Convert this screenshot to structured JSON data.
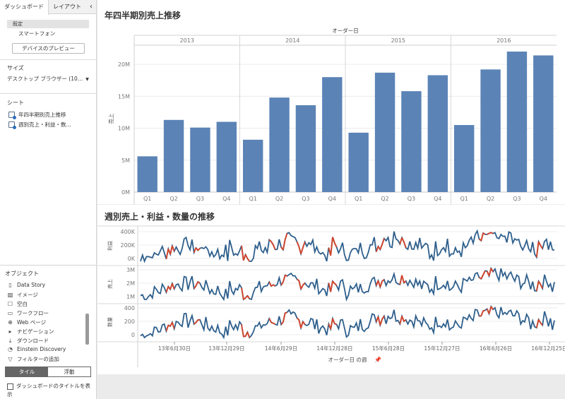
{
  "left_panel": {
    "tabs": {
      "dashboard": "ダッシュボード",
      "layout": "レイアウト",
      "collapse": "‹"
    },
    "device": {
      "default_label": "既定",
      "phone": "スマートフォン",
      "preview_button": "デバイスのプレビュー"
    },
    "size": {
      "label": "サイズ",
      "value": "デスクトップ ブラウザー (10…"
    },
    "sheets": {
      "label": "シート",
      "items": [
        "年四半期別売上推移",
        "週別売上・利益・数…"
      ]
    },
    "objects": {
      "label": "オブジェクト",
      "items": [
        {
          "label": "Data Story",
          "icon": "data-story-icon"
        },
        {
          "label": "イメージ",
          "icon": "image-icon"
        },
        {
          "label": "空白",
          "icon": "blank-icon"
        },
        {
          "label": "ワークフロー",
          "icon": "workflow-icon"
        },
        {
          "label": "Web ページ",
          "icon": "globe-icon"
        },
        {
          "label": "ナビゲーション",
          "icon": "navigation-icon"
        },
        {
          "label": "ダウンロード",
          "icon": "download-icon"
        },
        {
          "label": "Einstein Discovery",
          "icon": "einstein-icon"
        },
        {
          "label": "フィルターの追加",
          "icon": "filter-icon"
        }
      ]
    },
    "tile_toggle": {
      "tile": "タイル",
      "float": "浮動"
    },
    "show_title": "ダッシュボードのタイトルを表示"
  },
  "bar_chart_title": "年四半期別売上推移",
  "line_chart_title": "週別売上・利益・数量の推移",
  "chart_data": [
    {
      "type": "bar",
      "title": "年四半期別売上推移",
      "top_header": "オーダー日",
      "years": [
        "2013",
        "2014",
        "2015",
        "2016"
      ],
      "quarters": [
        "Q1",
        "Q2",
        "Q3",
        "Q4"
      ],
      "ylabel": "売上",
      "ylim": [
        0,
        23000000
      ],
      "yticks": [
        0,
        5000000,
        10000000,
        15000000,
        20000000
      ],
      "ytick_labels": [
        "0M",
        "5M",
        "10M",
        "15M",
        "20M"
      ],
      "values": [
        5.6,
        11.3,
        10.1,
        11.0,
        8.2,
        14.8,
        13.6,
        18.0,
        9.3,
        18.7,
        15.8,
        18.3,
        10.5,
        19.2,
        22.0,
        21.4
      ],
      "value_unit": "M",
      "bar_color": "#5b83b6"
    },
    {
      "type": "line",
      "title": "週別売上・利益・数量の推移",
      "xlabel": "オーダー日 の週",
      "x_tick_labels": [
        "13年6月30日",
        "13年12月29日",
        "14年6月29日",
        "14年12月28日",
        "15年6月28日",
        "15年12月27日",
        "16年6月26日",
        "16年12月25日"
      ],
      "line_color": "#2e5f8c",
      "highlight_color": "#d2442b",
      "panes": [
        {
          "name": "利益",
          "ytick_labels": [
            "0K",
            "200K",
            "400K"
          ],
          "ylim": [
            -100000,
            520000
          ]
        },
        {
          "name": "売上",
          "ytick_labels": [
            "1M",
            "2M",
            "3M"
          ],
          "ylim": [
            0,
            3400000
          ]
        },
        {
          "name": "数量",
          "ytick_labels": [
            "0",
            "200",
            "400"
          ],
          "ylim": [
            -40,
            430
          ]
        }
      ]
    }
  ]
}
